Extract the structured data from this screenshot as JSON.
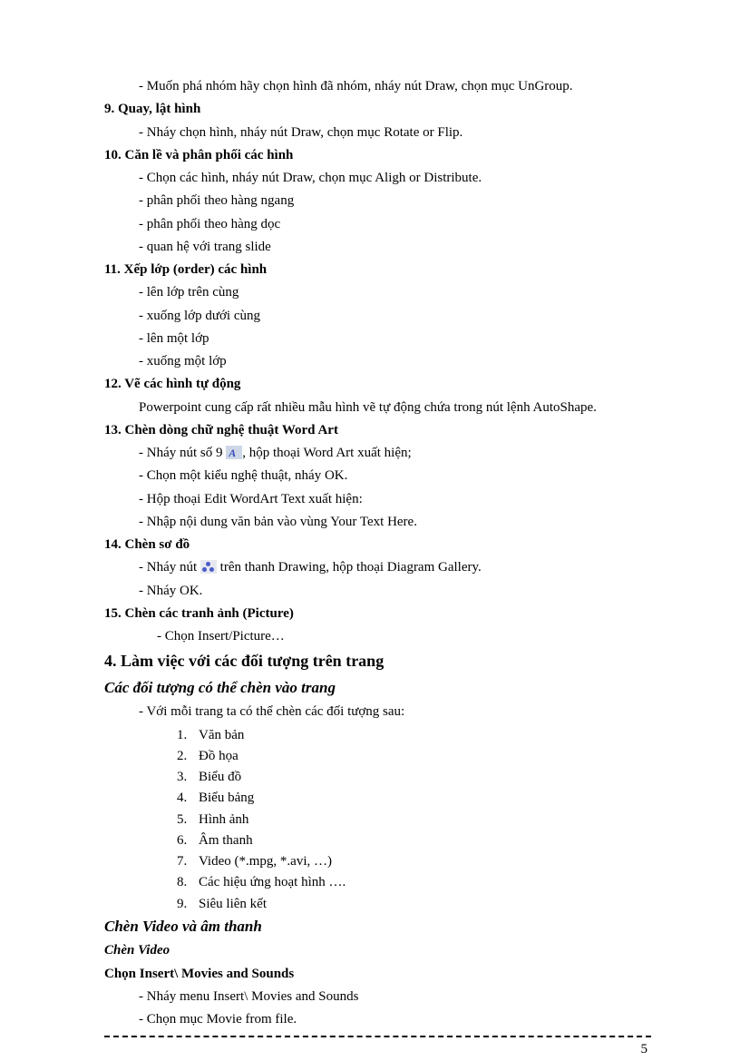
{
  "lines": {
    "l0": "- Muốn phá nhóm  hãy chọn hình  đã nhóm,  nháy  nút Draw,  chọn mục  UnGroup.",
    "s9": "9. Quay, lật hình",
    "l1": "- Nháy chọn hình,  nháy nút Draw,  chọn mục  Rotate or Flip.",
    "s10": "10. Căn lề và phân phối các hình",
    "l2": "- Chọn các hình,  nháy nút Draw, chọn mục  Aligh  or Distribute.",
    "l3": "- phân phối theo hàng ngang",
    "l4": "- phân phối theo hàng dọc",
    "l5": "- quan hệ với trang slide",
    "s11": "11. Xếp lớp (order)  các hình",
    "l6": "- lên lớp trên cùng",
    "l7": "- xuống lớp dưới cùng",
    "l8": "- lên một lớp",
    "l9": "- xuống một lớp",
    "s12": "12. Vẽ các hình tự động",
    "l10": "Powerpoint  cung  cấp rất nhiều  mẫu hình  vẽ tự động chứa trong nút lệnh  AutoShape.",
    "s13": "13. Chèn dòng chữ nghệ thuật  Word Art",
    "l11a": "- Nháy  nút số 9  ",
    "l11b": ",  hộp thoại  Word Art xuất hiện;",
    "l12": "- Chọn một kiểu nghệ thuật,  nháy OK.",
    "l13": "- Hộp thoại  Edit  WordArt Text  xuất hiện:",
    "l14": "- Nhập nội dung  văn  bản vào vùng  Your Text Here.",
    "s14": "14. Chèn sơ đồ",
    "l15a": "- Nháy nút  ",
    "l15b": " trên thanh  Drawing,  hộp thoại  Diagram  Gallery.",
    "l16": "- Nháy OK.",
    "s15": "15. Chèn các tranh  ảnh (Picture)",
    "l17": "- Chọn Insert/Picture…",
    "h4": "4. Làm  việc với các đối tượng trên trang",
    "sh1": "Các đối tượng có thể chèn  vào trang",
    "l18": "- Với mỗi trang ta có thể chèn các đối tượng  sau:",
    "ol1": "Văn bản",
    "ol2": "Đồ họa",
    "ol3": "Biểu  đồ",
    "ol4": "Biểu  bảng",
    "ol5": "Hình ảnh",
    "ol6": "Âm thanh",
    "ol7": "Video  (*.mpg,  *.avi, …)",
    "ol8": "Các hiệu  ứng hoạt hình  ….",
    "ol9": "Siêu liên kết",
    "sh2": "Chèn Video và âm thanh",
    "sh3": "Chèn Video",
    "sh4": "Chọn  Insert\\  Movies  and Sounds",
    "l19": "- Nháy menu  Insert\\  Movies  and Sounds",
    "l20": "- Chọn mục  Movie  from  file.",
    "pageNum": "5"
  }
}
